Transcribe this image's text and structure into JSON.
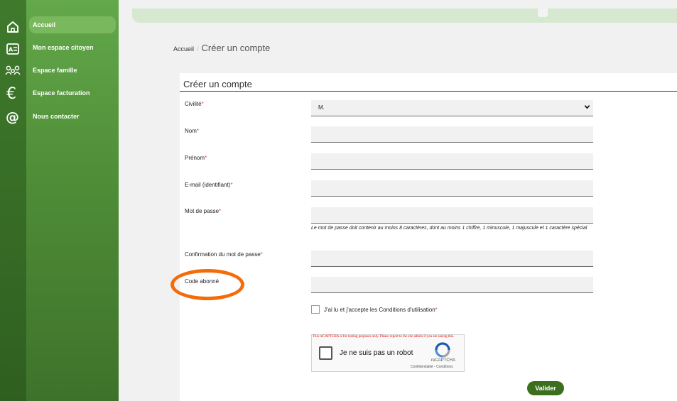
{
  "sidebar": {
    "items": [
      {
        "label": "Accueil",
        "icon": "home-icon"
      },
      {
        "label": "Mon espace citoyen",
        "icon": "id-card-icon"
      },
      {
        "label": "Espace famille",
        "icon": "family-icon"
      },
      {
        "label": "Espace facturation",
        "icon": "euro-icon"
      },
      {
        "label": "Nous contacter",
        "icon": "at-icon"
      }
    ]
  },
  "breadcrumb": {
    "home": "Accueil",
    "separator": "/",
    "current": "Créer un compte"
  },
  "form": {
    "title": "Créer un compte",
    "civility": {
      "label": "Civilité",
      "value": "M."
    },
    "last_name": {
      "label": "Nom",
      "value": ""
    },
    "first_name": {
      "label": "Prénom",
      "value": ""
    },
    "email": {
      "label": "E-mail (identifiant)",
      "value": ""
    },
    "password": {
      "label": "Mot de passe",
      "value": "",
      "hint": "Le mot de passe doit contenir au moins 8 caractères, dont au moins 1 chiffre, 1 minuscule, 1 majuscule et 1 caractère spécial"
    },
    "password_confirm": {
      "label": "Confirmation du mot de passe",
      "value": ""
    },
    "subscriber_code": {
      "label": "Code abonné",
      "value": ""
    },
    "terms": {
      "label": "J'ai lu et j'accepte les Conditions d'utilisation",
      "checked": false
    },
    "required_mark": "*",
    "submit_label": "Valider"
  },
  "captcha": {
    "warning": "This reCAPTCHA is for testing purposes only. Please report to the site admin if you are seeing this.",
    "label": "Je ne suis pas un robot",
    "brand": "reCAPTCHA",
    "links": "Confidentialité - Conditions"
  },
  "colors": {
    "sidebar_green": "#4f8d37",
    "submit_green": "#3b6f1d",
    "highlight_orange": "#f36c0a",
    "required_red": "#e74c3c"
  }
}
